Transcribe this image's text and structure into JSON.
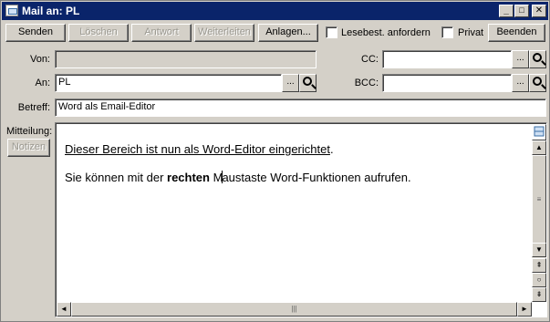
{
  "window": {
    "title": "Mail an: PL",
    "controls": {
      "minimize": "_",
      "maximize": "□",
      "close": "✕"
    }
  },
  "toolbar": {
    "send": "Senden",
    "delete": "Löschen",
    "reply": "Antwort",
    "forward": "Weiterleiten",
    "attachments": "Anlagen...",
    "read_receipt": "Lesebest. anfordern",
    "private": "Privat",
    "close": "Beenden"
  },
  "form": {
    "from_label": "Von:",
    "from_value": "",
    "to_label": "An:",
    "to_value": "PL",
    "cc_label": "CC:",
    "cc_value": "",
    "bcc_label": "BCC:",
    "bcc_value": "",
    "subject_label": "Betreff:",
    "subject_value": "Word als Email-Editor",
    "message_label": "Mitteilung:",
    "notes_button": "Notizen",
    "browse": "..."
  },
  "editor": {
    "line1": "Dieser Bereich ist nun als Word-Editor eingerichtet",
    "line1_end": ".",
    "line2_before": "Sie können mit der ",
    "line2_bold": "rechten",
    "line2_after_caret_1": " M",
    "line2_after_caret_2": "austaste Word-Funktionen aufrufen."
  },
  "scrollbars": {
    "up": "▲",
    "down": "▼",
    "left": "◄",
    "right": "►",
    "prev_page": "⇞",
    "browse_object": "○",
    "next_page": "⇟",
    "grip": "≡",
    "h_grip": "|||"
  },
  "icons": {
    "magnifier": "search-icon",
    "split": "split-view-icon"
  },
  "colors": {
    "titlebar": "#0a246a",
    "face": "#d4d0c8"
  }
}
